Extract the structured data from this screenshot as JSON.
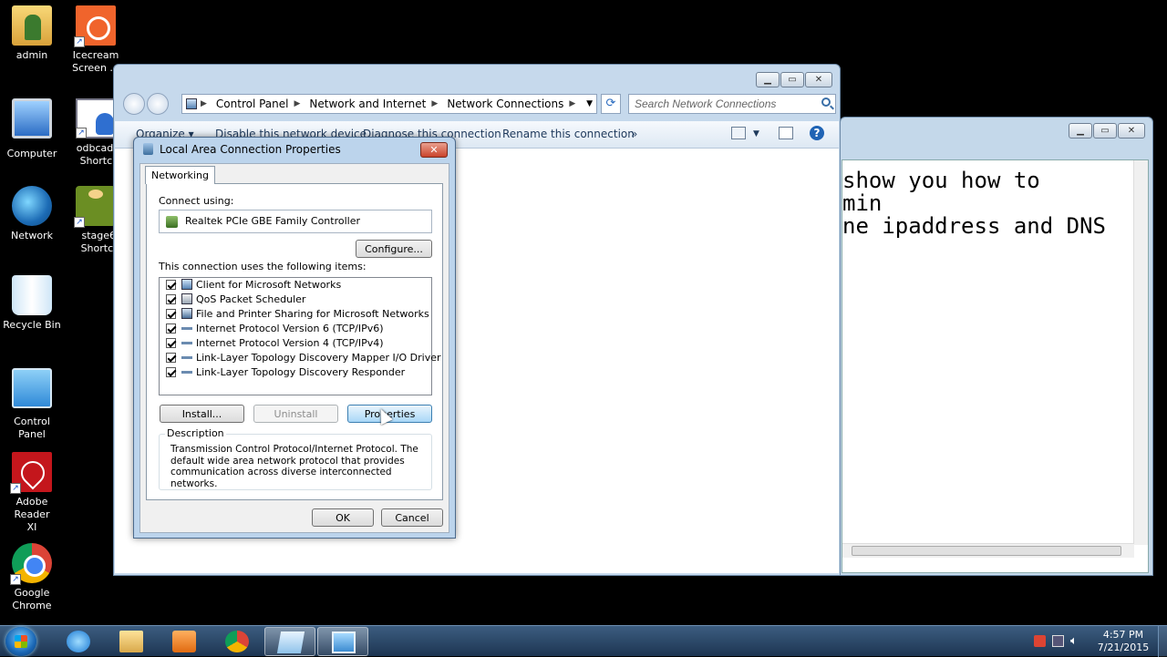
{
  "desktop": {
    "icons": [
      {
        "label": "admin"
      },
      {
        "label": "Icecream Screen ..."
      },
      {
        "label": "Computer"
      },
      {
        "label": "odbcad32 Shortcut"
      },
      {
        "label": "Network"
      },
      {
        "label": "stage6 - Shortcut"
      },
      {
        "label": "Recycle Bin"
      },
      {
        "label": "Control Panel"
      },
      {
        "label": "Adobe Reader XI"
      },
      {
        "label": "Google Chrome"
      }
    ]
  },
  "notepad": {
    "lines": [
      "show you how to",
      "min",
      "ne ipaddress and DNS"
    ]
  },
  "explorer": {
    "breadcrumb": [
      "Control Panel",
      "Network and Internet",
      "Network Connections"
    ],
    "search_placeholder": "Search Network Connections",
    "toolbar": {
      "organize": "Organize ▾",
      "disable": "Disable this network device",
      "diagnose": "Diagnose this connection",
      "rename": "Rename this connection",
      "more": "»"
    }
  },
  "dialog": {
    "title": "Local Area Connection Properties",
    "tab": "Networking",
    "connect_using_label": "Connect using:",
    "adapter": "Realtek PCIe GBE Family Controller",
    "configure_label": "Configure...",
    "items_label": "This connection uses the following items:",
    "items": [
      {
        "label": "Client for Microsoft Networks",
        "checked": true,
        "icon": "client-icon"
      },
      {
        "label": "QoS Packet Scheduler",
        "checked": true,
        "icon": "scheduler-icon"
      },
      {
        "label": "File and Printer Sharing for Microsoft Networks",
        "checked": true,
        "icon": "sharing-icon"
      },
      {
        "label": "Internet Protocol Version 6 (TCP/IPv6)",
        "checked": true,
        "icon": "protocol-icon"
      },
      {
        "label": "Internet Protocol Version 4 (TCP/IPv4)",
        "checked": true,
        "icon": "protocol-icon"
      },
      {
        "label": "Link-Layer Topology Discovery Mapper I/O Driver",
        "checked": true,
        "icon": "protocol-icon"
      },
      {
        "label": "Link-Layer Topology Discovery Responder",
        "checked": true,
        "icon": "protocol-icon"
      }
    ],
    "install_label": "Install...",
    "uninstall_label": "Uninstall",
    "properties_label": "Properties",
    "description_label": "Description",
    "description_text": "Transmission Control Protocol/Internet Protocol. The default wide area network protocol that provides communication across diverse interconnected networks.",
    "ok_label": "OK",
    "cancel_label": "Cancel"
  },
  "taskbar": {
    "time": "4:57 PM",
    "date": "7/21/2015"
  }
}
